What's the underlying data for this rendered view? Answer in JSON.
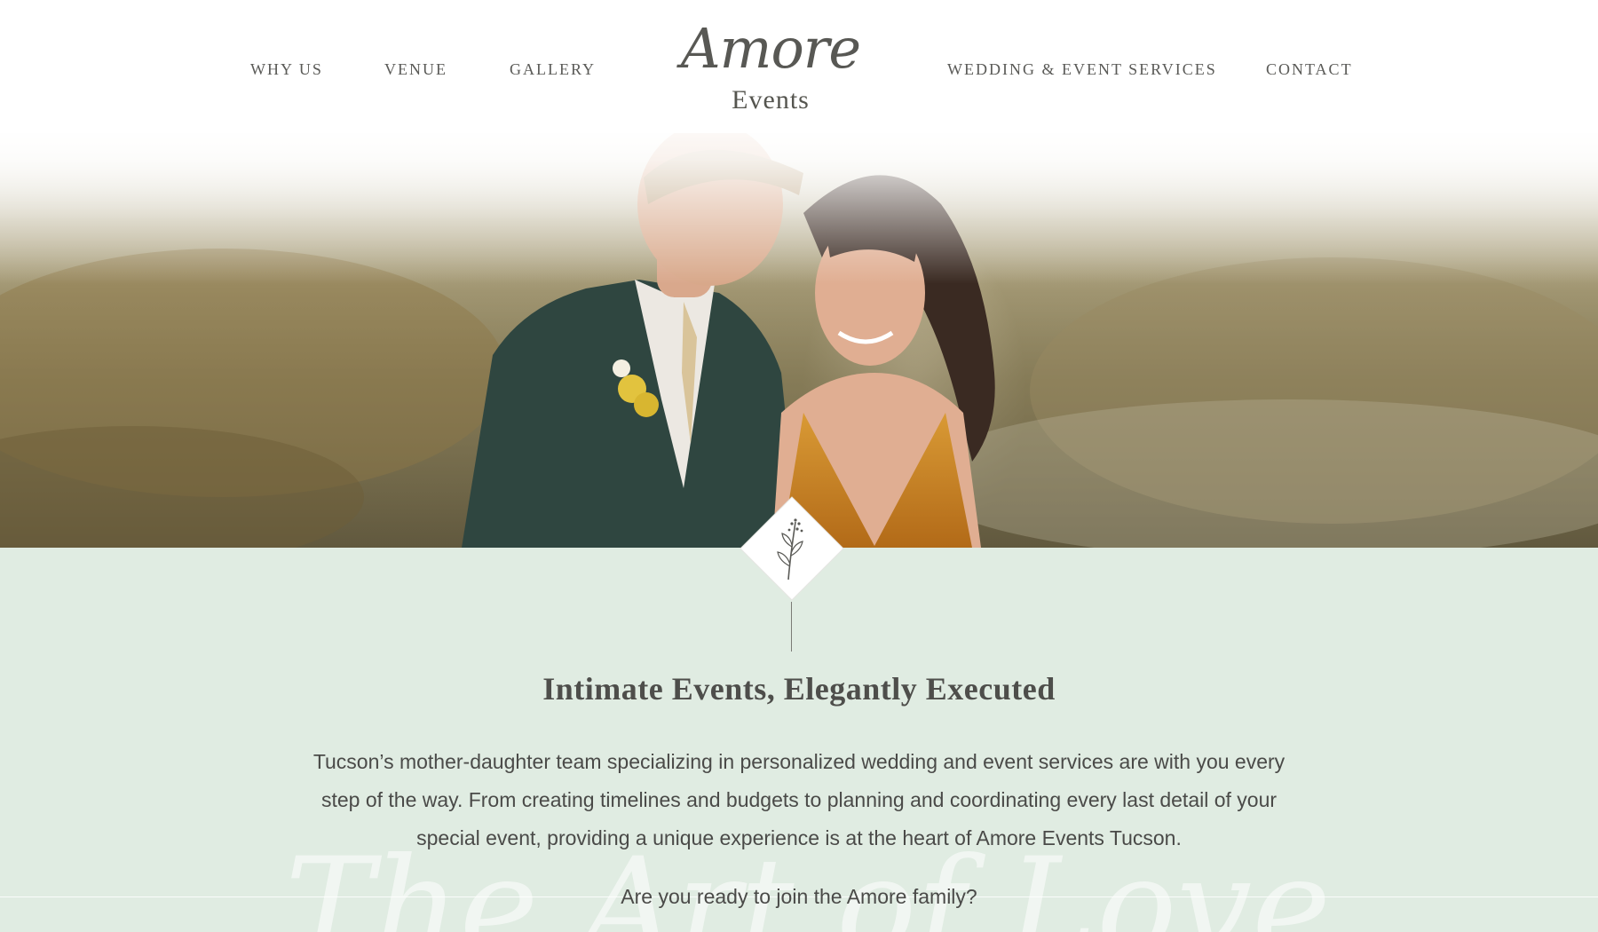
{
  "nav": {
    "left": [
      "WHY US",
      "VENUE",
      "GALLERY"
    ],
    "right": [
      "WEDDING & EVENT SERVICES",
      "CONTACT"
    ]
  },
  "logo": {
    "script": "Amore",
    "sub": "Events"
  },
  "intro": {
    "title": "Intimate Events, Elegantly Executed",
    "body": "Tucson’s mother-daughter team specializing in personalized wedding and event services are with you every step of the way. From creating timelines and budgets to planning and coordinating every last detail of your special event, providing a unique experience is at the heart of Amore Events Tucson.",
    "question": "Are you ready to join the Amore family?",
    "watermark": "The Art of Love"
  },
  "colors": {
    "section_bg": "#e0ece2",
    "text": "#4a4a48",
    "nav_text": "#5a5a57"
  },
  "icons": [
    "botanical-sprig-icon"
  ]
}
